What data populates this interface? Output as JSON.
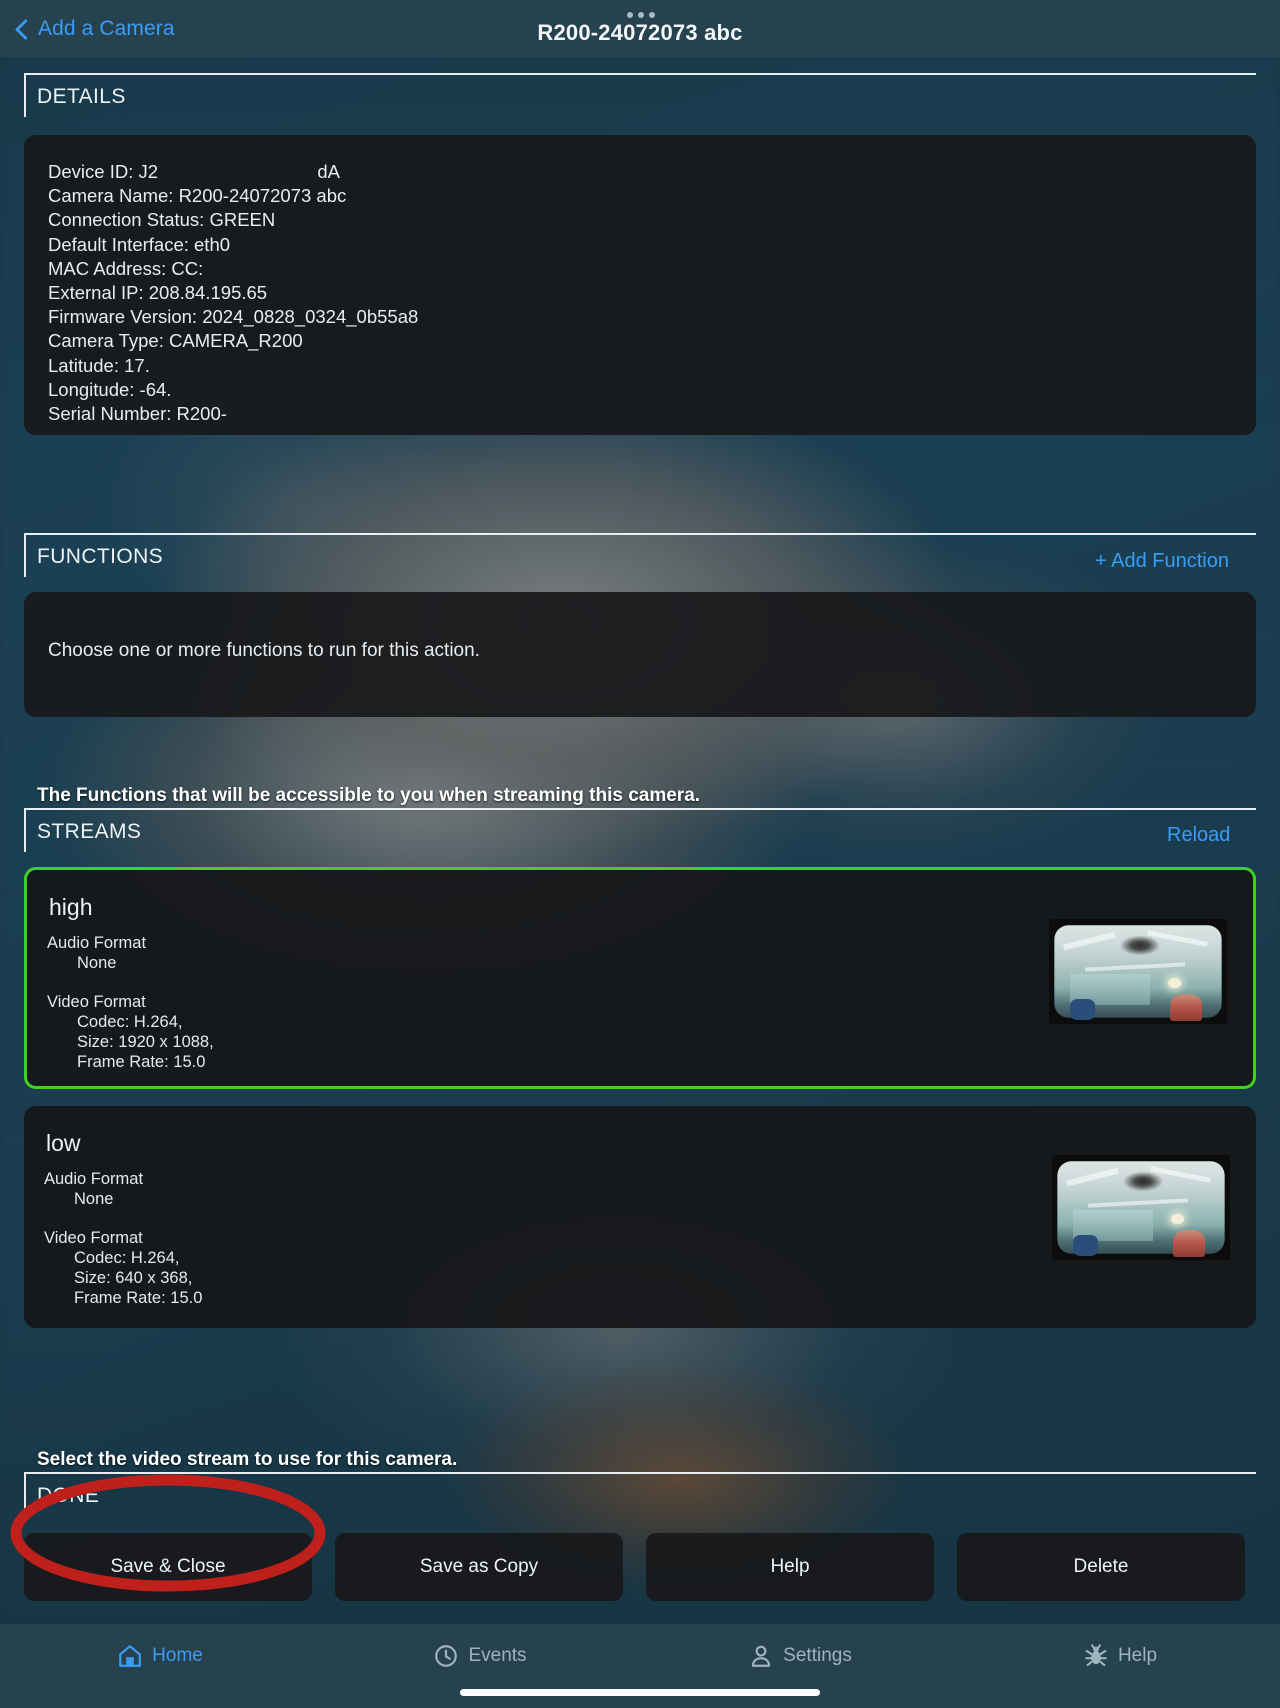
{
  "navbar": {
    "back_label": "Add a Camera",
    "back_icon": "chevron-left-icon",
    "title": "R200-24072073 abc",
    "more_icon": "more-dots-icon"
  },
  "details": {
    "section_title": "DETAILS",
    "lines": [
      "Device ID: J2                               dA",
      "Camera Name: R200-24072073 abc",
      "Connection Status: GREEN",
      "Default Interface: eth0",
      "MAC Address: CC:",
      "External IP: 208.84.195.65",
      "Firmware Version: 2024_0828_0324_0b55a8",
      "Camera Type: CAMERA_R200",
      "Latitude: 17.",
      "Longitude: -64.",
      "Serial Number: R200-"
    ]
  },
  "functions": {
    "section_title": "FUNCTIONS",
    "add_label": "+ Add Function",
    "placeholder": "Choose one or more functions to run for this action.",
    "note": "The Functions that will be accessible to you when streaming this camera."
  },
  "streams": {
    "section_title": "STREAMS",
    "reload_label": "Reload",
    "note": "Select the video stream to use for this camera.",
    "selected_color": "#3fd21f",
    "items": [
      {
        "name": "high",
        "selected": true,
        "audio_label": "Audio Format",
        "audio_value": "None",
        "video_label": "Video Format",
        "video_lines": [
          "Codec: H.264,",
          "Size: 1920 x 1088,",
          "Frame Rate: 15.0"
        ],
        "thumbnail": "camera-preview-thumbnail"
      },
      {
        "name": "low",
        "selected": false,
        "audio_label": "Audio Format",
        "audio_value": "None",
        "video_label": "Video Format",
        "video_lines": [
          "Codec: H.264,",
          "Size: 640 x 368,",
          "Frame Rate: 15.0"
        ],
        "thumbnail": "camera-preview-thumbnail"
      }
    ]
  },
  "done": {
    "section_title": "DONE",
    "buttons": [
      {
        "label": "Save & Close"
      },
      {
        "label": "Save as Copy"
      },
      {
        "label": "Help"
      },
      {
        "label": "Delete"
      }
    ]
  },
  "annotation": {
    "shape": "red-ellipse-highlight",
    "color": "#c0201c",
    "targets": "Save & Close"
  },
  "tabbar": {
    "items": [
      {
        "label": "Home",
        "icon": "home-icon",
        "active": true
      },
      {
        "label": "Events",
        "icon": "clock-icon",
        "active": false
      },
      {
        "label": "Settings",
        "icon": "person-icon",
        "active": false
      },
      {
        "label": "Help",
        "icon": "bug-icon",
        "active": false
      }
    ],
    "active_color": "#3b9cf5",
    "inactive_color": "#9fb3bd"
  }
}
